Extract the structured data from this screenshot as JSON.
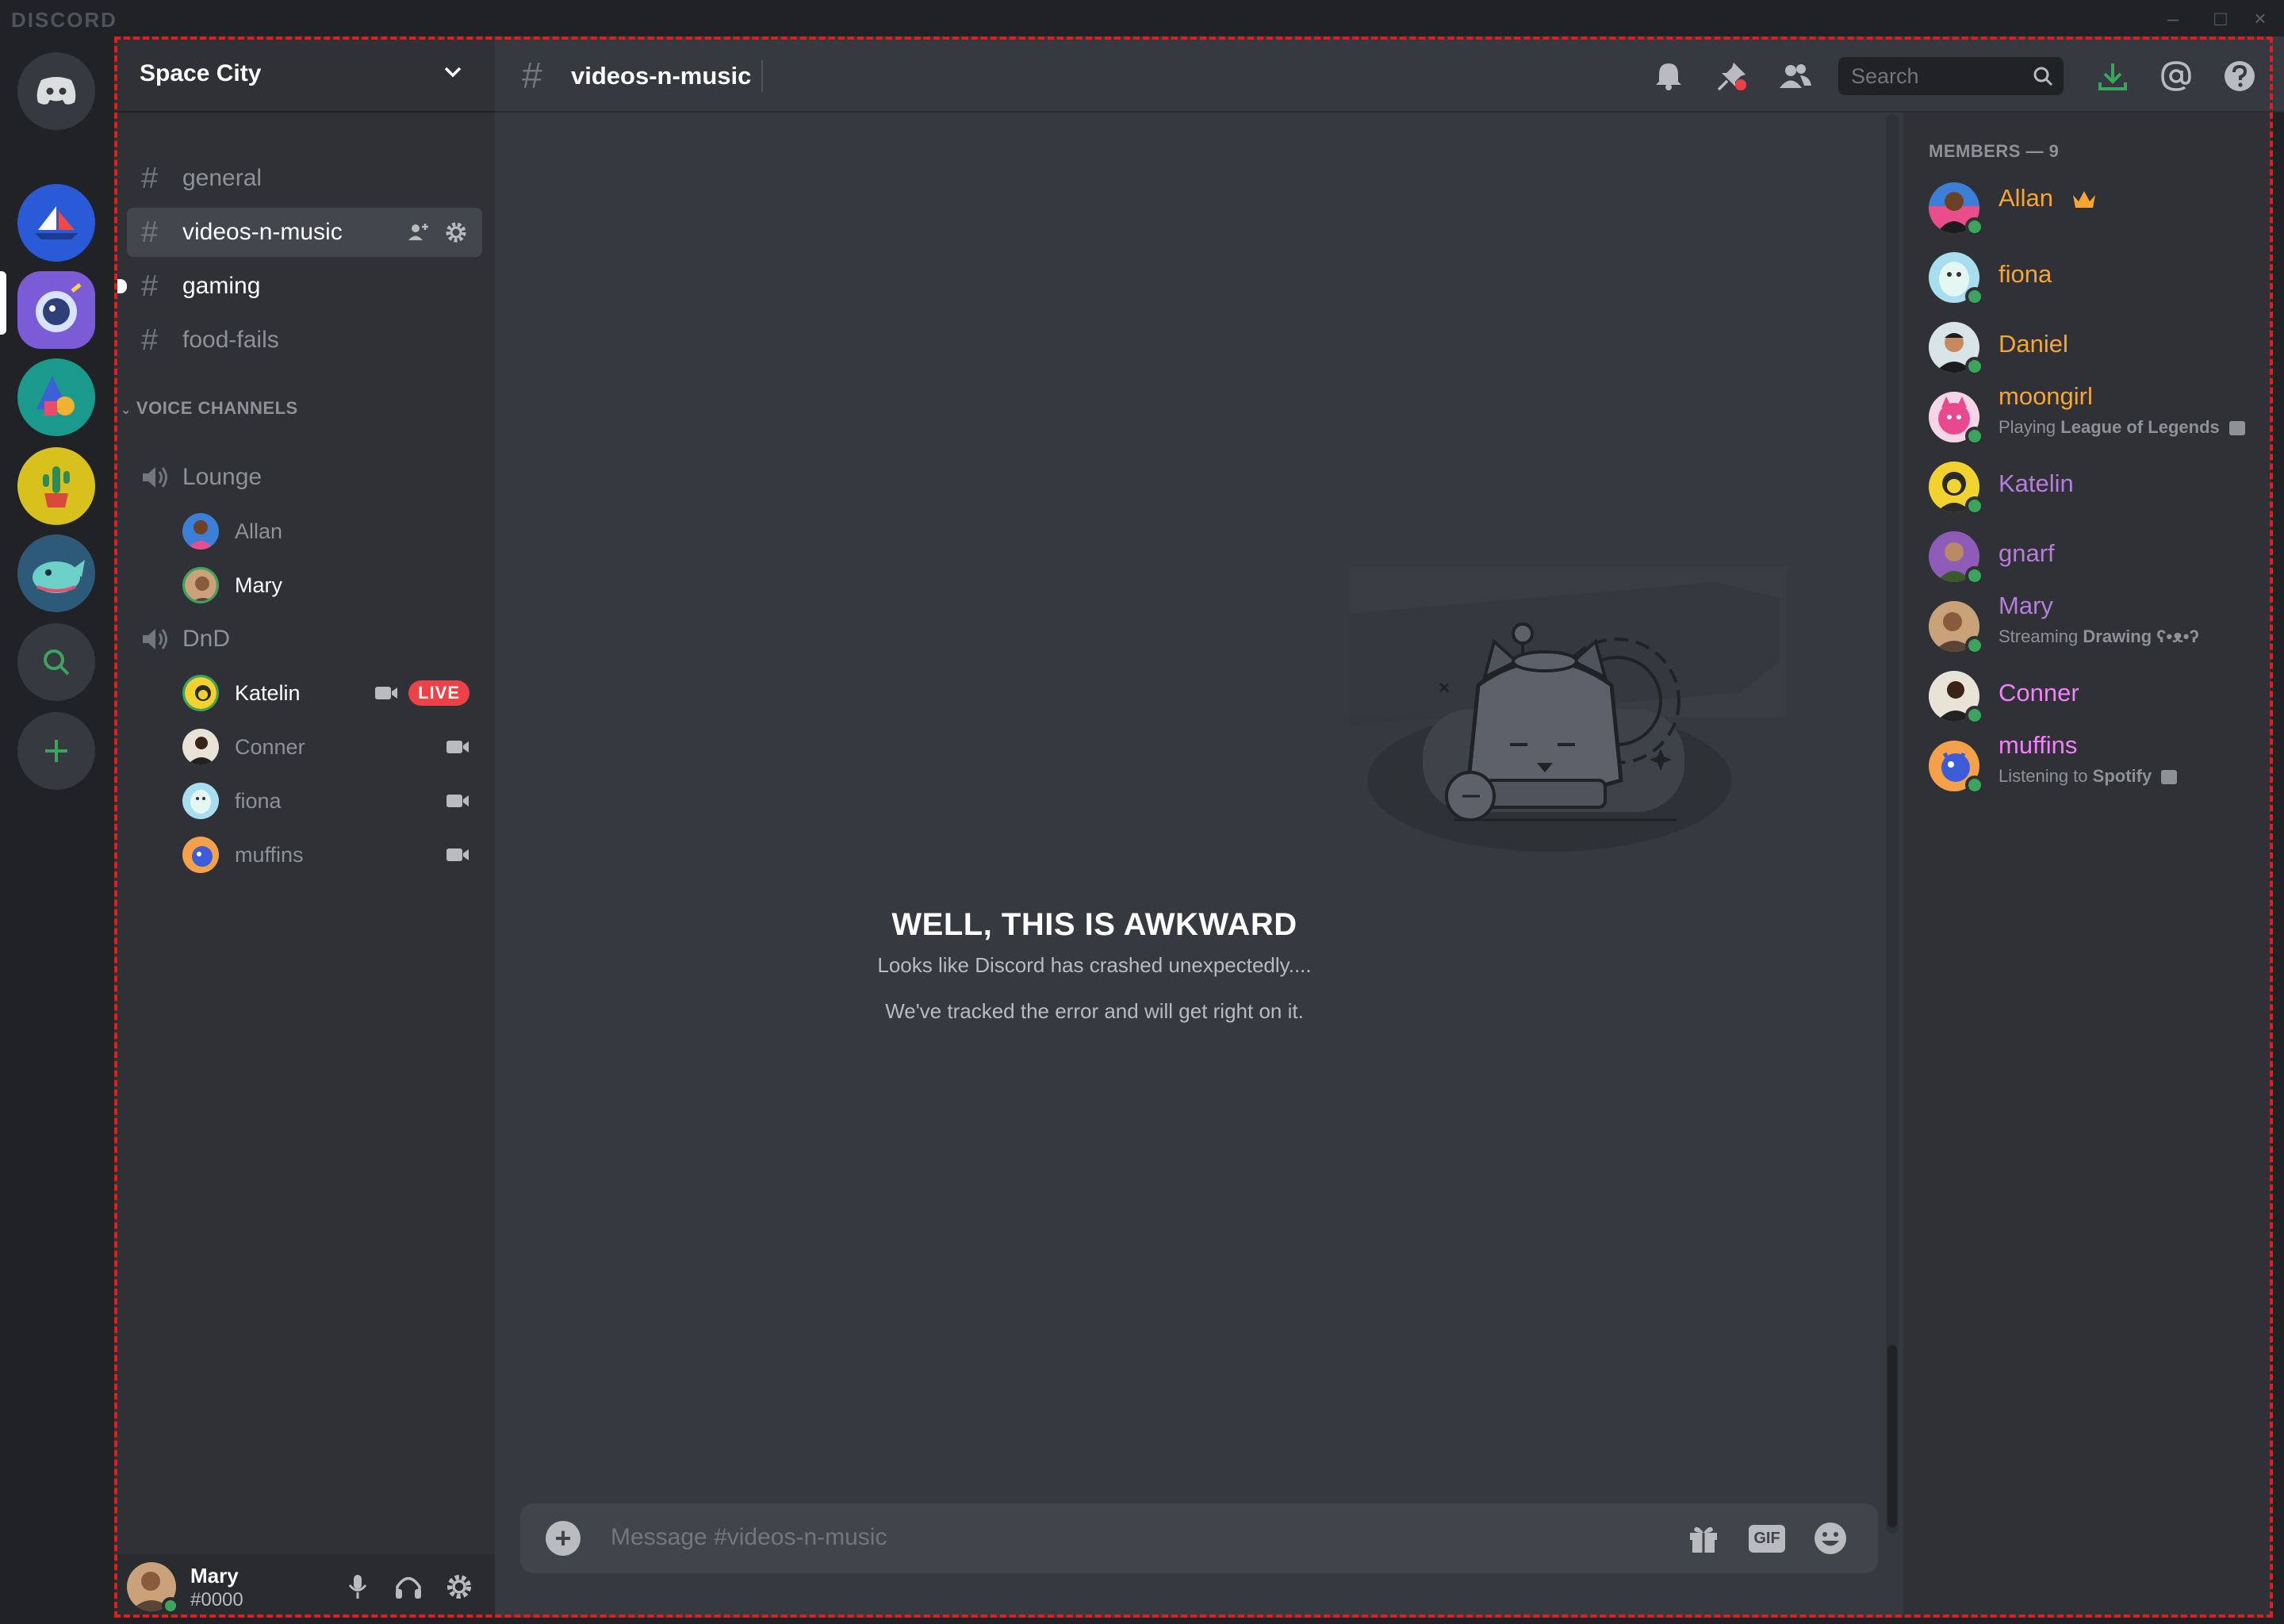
{
  "app": {
    "brand": "DISCORD"
  },
  "server": {
    "name": "Space City"
  },
  "channels": {
    "text": [
      {
        "name": "general"
      },
      {
        "name": "videos-n-music"
      },
      {
        "name": "gaming"
      },
      {
        "name": "food-fails"
      }
    ],
    "voice_category": "VOICE CHANNELS",
    "voice": [
      {
        "name": "Lounge",
        "users": [
          "Allan",
          "Mary"
        ]
      },
      {
        "name": "DnD",
        "users": [
          "Katelin",
          "Conner",
          "fiona",
          "muffins"
        ]
      }
    ],
    "live_badge": "LIVE"
  },
  "user": {
    "name": "Mary",
    "tag": "#0000"
  },
  "header": {
    "channel": "videos-n-music",
    "search_placeholder": "Search"
  },
  "crash": {
    "title": "WELL, THIS IS AWKWARD",
    "line1": "Looks like Discord has crashed unexpectedly....",
    "line2": "We've tracked the error and will get right on it."
  },
  "composer": {
    "placeholder": "Message #videos-n-music",
    "gif_label": "GIF"
  },
  "members": {
    "heading": "MEMBERS — 9",
    "list": [
      {
        "name": "Allan",
        "color": "#f8a532"
      },
      {
        "name": "fiona",
        "color": "#f8a532"
      },
      {
        "name": "Daniel",
        "color": "#f8a532"
      },
      {
        "name": "moongirl",
        "color": "#f8a532",
        "activity_prefix": "Playing ",
        "activity_bold": "League of Legends"
      },
      {
        "name": "Katelin",
        "color": "#b57edc"
      },
      {
        "name": "gnarf",
        "color": "#b57edc"
      },
      {
        "name": "Mary",
        "color": "#b57edc",
        "activity_prefix": "Streaming ",
        "activity_bold": "Drawing ʕ•ᴥ•ʔ"
      },
      {
        "name": "Conner",
        "color": "#f47fff"
      },
      {
        "name": "muffins",
        "color": "#f47fff",
        "activity_prefix": "Listening to ",
        "activity_bold": "Spotify"
      }
    ]
  },
  "colors": {
    "accent": "#5865f2",
    "online": "#3ba55d",
    "live": "#ed4245",
    "download": "#3ba55d"
  }
}
